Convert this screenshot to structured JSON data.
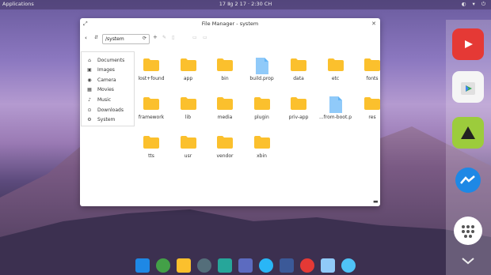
{
  "topbar": {
    "applications": "Applications",
    "clock": "17 Ⅱg 2 17 · 2:30 CH"
  },
  "window": {
    "title": "File Manager - system"
  },
  "toolbar": {
    "path": "/system"
  },
  "sidebar": {
    "items": [
      {
        "label": "Documents",
        "icon": "home-icon"
      },
      {
        "label": "Images",
        "icon": "image-icon"
      },
      {
        "label": "Camera",
        "icon": "camera-icon"
      },
      {
        "label": "Movies",
        "icon": "movie-icon"
      },
      {
        "label": "Music",
        "icon": "music-icon"
      },
      {
        "label": "Downloads",
        "icon": "download-icon"
      },
      {
        "label": "System",
        "icon": "system-icon"
      }
    ]
  },
  "files": [
    {
      "name": "lost+found",
      "type": "folder"
    },
    {
      "name": "app",
      "type": "folder"
    },
    {
      "name": "bin",
      "type": "folder"
    },
    {
      "name": "build.prop",
      "type": "file"
    },
    {
      "name": "data",
      "type": "folder"
    },
    {
      "name": "etc",
      "type": "folder"
    },
    {
      "name": "fonts",
      "type": "folder"
    },
    {
      "name": "framework",
      "type": "folder"
    },
    {
      "name": "lib",
      "type": "folder"
    },
    {
      "name": "media",
      "type": "folder"
    },
    {
      "name": "plugin",
      "type": "folder"
    },
    {
      "name": "priv-app",
      "type": "folder"
    },
    {
      "name": "...from-boot.p",
      "type": "file"
    },
    {
      "name": "res",
      "type": "folder"
    },
    {
      "name": "tts",
      "type": "folder"
    },
    {
      "name": "usr",
      "type": "folder"
    },
    {
      "name": "vendor",
      "type": "folder"
    },
    {
      "name": "xbin",
      "type": "folder"
    }
  ],
  "colors": {
    "folder": "#fbc02d",
    "file": "#90caf9",
    "accent": "#e53935"
  },
  "right_dock": [
    "youtube-icon",
    "play-store-icon",
    "feedly-icon",
    "messenger-icon",
    "app-drawer-icon",
    "chevron-down-icon"
  ],
  "bottom_dock": [
    "grid-icon",
    "globe-icon",
    "folder-icon",
    "settings-icon",
    "store-icon",
    "volume-icon",
    "twitter-icon",
    "facebook-icon",
    "youtube-icon",
    "files-icon",
    "telegram-icon"
  ]
}
